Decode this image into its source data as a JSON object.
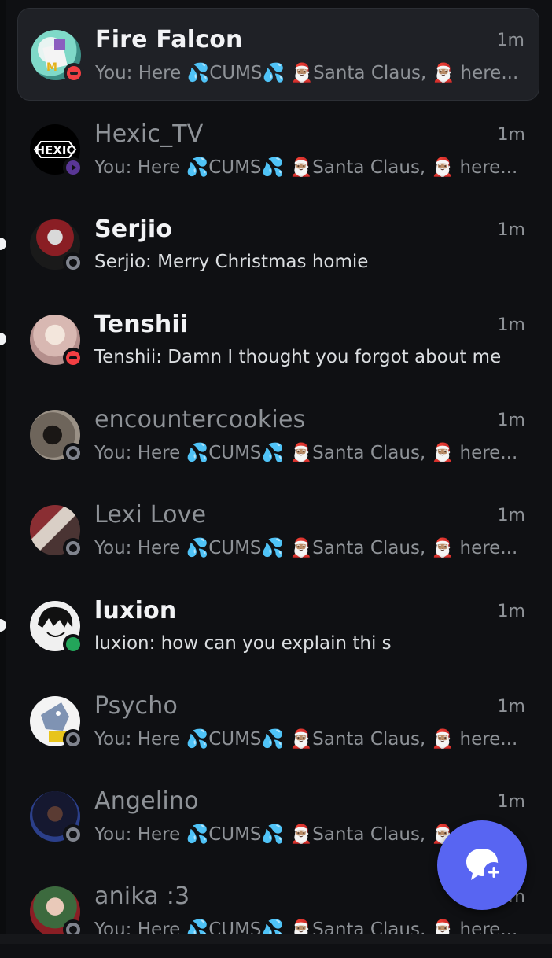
{
  "dms": [
    {
      "name": "Fire Falcon",
      "time": "1m",
      "preview": "You: Here 💦CUMS💦 🎅🏽Santa Claus, 🎅🏽 here...",
      "status": "dnd",
      "unread": false,
      "selected": true,
      "muted": false,
      "avatar_color": "#7fd9c8"
    },
    {
      "name": "Hexic_TV",
      "time": "1m",
      "preview": "You: Here 💦CUMS💦 🎅🏽Santa Claus, 🎅🏽 here...",
      "status": "streaming",
      "unread": false,
      "selected": false,
      "muted": true,
      "avatar_color": "#000000",
      "avatar_text": "HEXIC"
    },
    {
      "name": "Serjio",
      "time": "1m",
      "preview": "Serjio: Merry Christmas homie",
      "status": "offline",
      "unread": true,
      "selected": false,
      "muted": false,
      "avatar_color": "#5a1f22"
    },
    {
      "name": "Tenshii",
      "time": "1m",
      "preview": "Tenshii: Damn I thought you forgot about me",
      "status": "dnd",
      "unread": true,
      "selected": false,
      "muted": false,
      "avatar_color": "#c9a7a6"
    },
    {
      "name": "encountercookies",
      "time": "1m",
      "preview": "You: Here 💦CUMS💦 🎅🏽Santa Claus, 🎅🏽 here...",
      "status": "offline",
      "unread": false,
      "selected": false,
      "muted": true,
      "avatar_color": "#4a433b"
    },
    {
      "name": "Lexi Love",
      "time": "1m",
      "preview": "You: Here 💦CUMS💦 🎅🏽Santa Claus, 🎅🏽 here...",
      "status": "offline",
      "unread": false,
      "selected": false,
      "muted": true,
      "avatar_color": "#6b3a3a"
    },
    {
      "name": "luxion",
      "time": "1m",
      "preview": "luxion: how can you explain thi s",
      "status": "online",
      "unread": true,
      "selected": false,
      "muted": false,
      "avatar_color": "#e8e8e8"
    },
    {
      "name": "Psycho",
      "time": "1m",
      "preview": "You: Here 💦CUMS💦 🎅🏽Santa Claus, 🎅🏽 here...",
      "status": "offline",
      "unread": false,
      "selected": false,
      "muted": true,
      "avatar_color": "#8fa6c8"
    },
    {
      "name": "Angelino",
      "time": "1m",
      "preview": "You: Here 💦CUMS💦 🎅🏽Santa Claus, 🎅🏽 here...",
      "status": "offline",
      "unread": false,
      "selected": false,
      "muted": true,
      "avatar_color": "#1b1f3a"
    },
    {
      "name": "anika :3",
      "time": "1m",
      "preview": "You: Here 💦CUMS💦 🎅🏽Santa Claus, 🎅🏽 here...",
      "status": "offline",
      "unread": false,
      "selected": false,
      "muted": true,
      "avatar_color": "#3a5a3a"
    }
  ],
  "fab": {
    "icon": "new-message-icon"
  },
  "colors": {
    "accent": "#5865f2",
    "dnd": "#f23f43",
    "online": "#23a55a",
    "offline": "#80848e",
    "streaming": "#593695"
  }
}
